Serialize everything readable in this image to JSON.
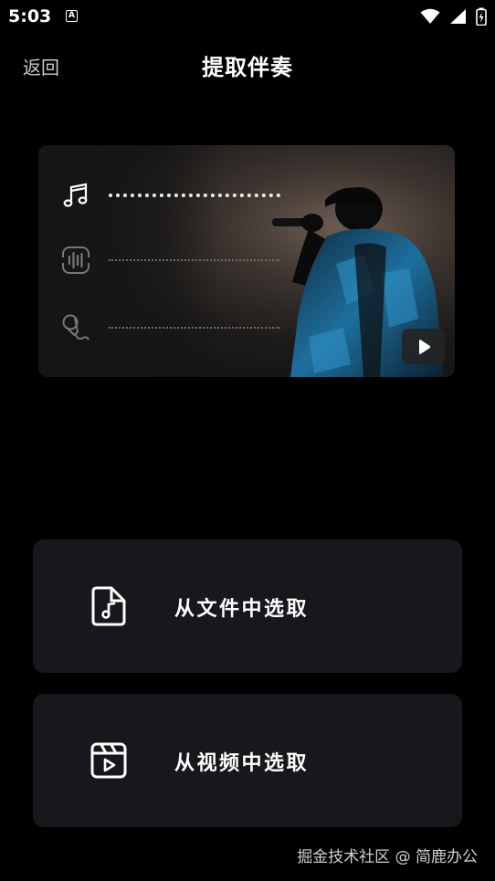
{
  "status_bar": {
    "time": "5:03",
    "notification_badge": "A"
  },
  "header": {
    "back_label": "返回",
    "title": "提取伴奏"
  },
  "preview": {
    "tracks": [
      {
        "icon": "music-note-icon"
      },
      {
        "icon": "audio-wave-icon"
      },
      {
        "icon": "microphone-icon"
      }
    ]
  },
  "options": [
    {
      "icon": "audio-file-icon",
      "label": "从文件中选取"
    },
    {
      "icon": "video-clip-icon",
      "label": "从视频中选取"
    }
  ],
  "watermark": "掘金技术社区 @ 简鹿办公",
  "colors": {
    "background": "#000000",
    "card": "#17181b",
    "text": "#ffffff",
    "muted": "#c7c8cc"
  }
}
